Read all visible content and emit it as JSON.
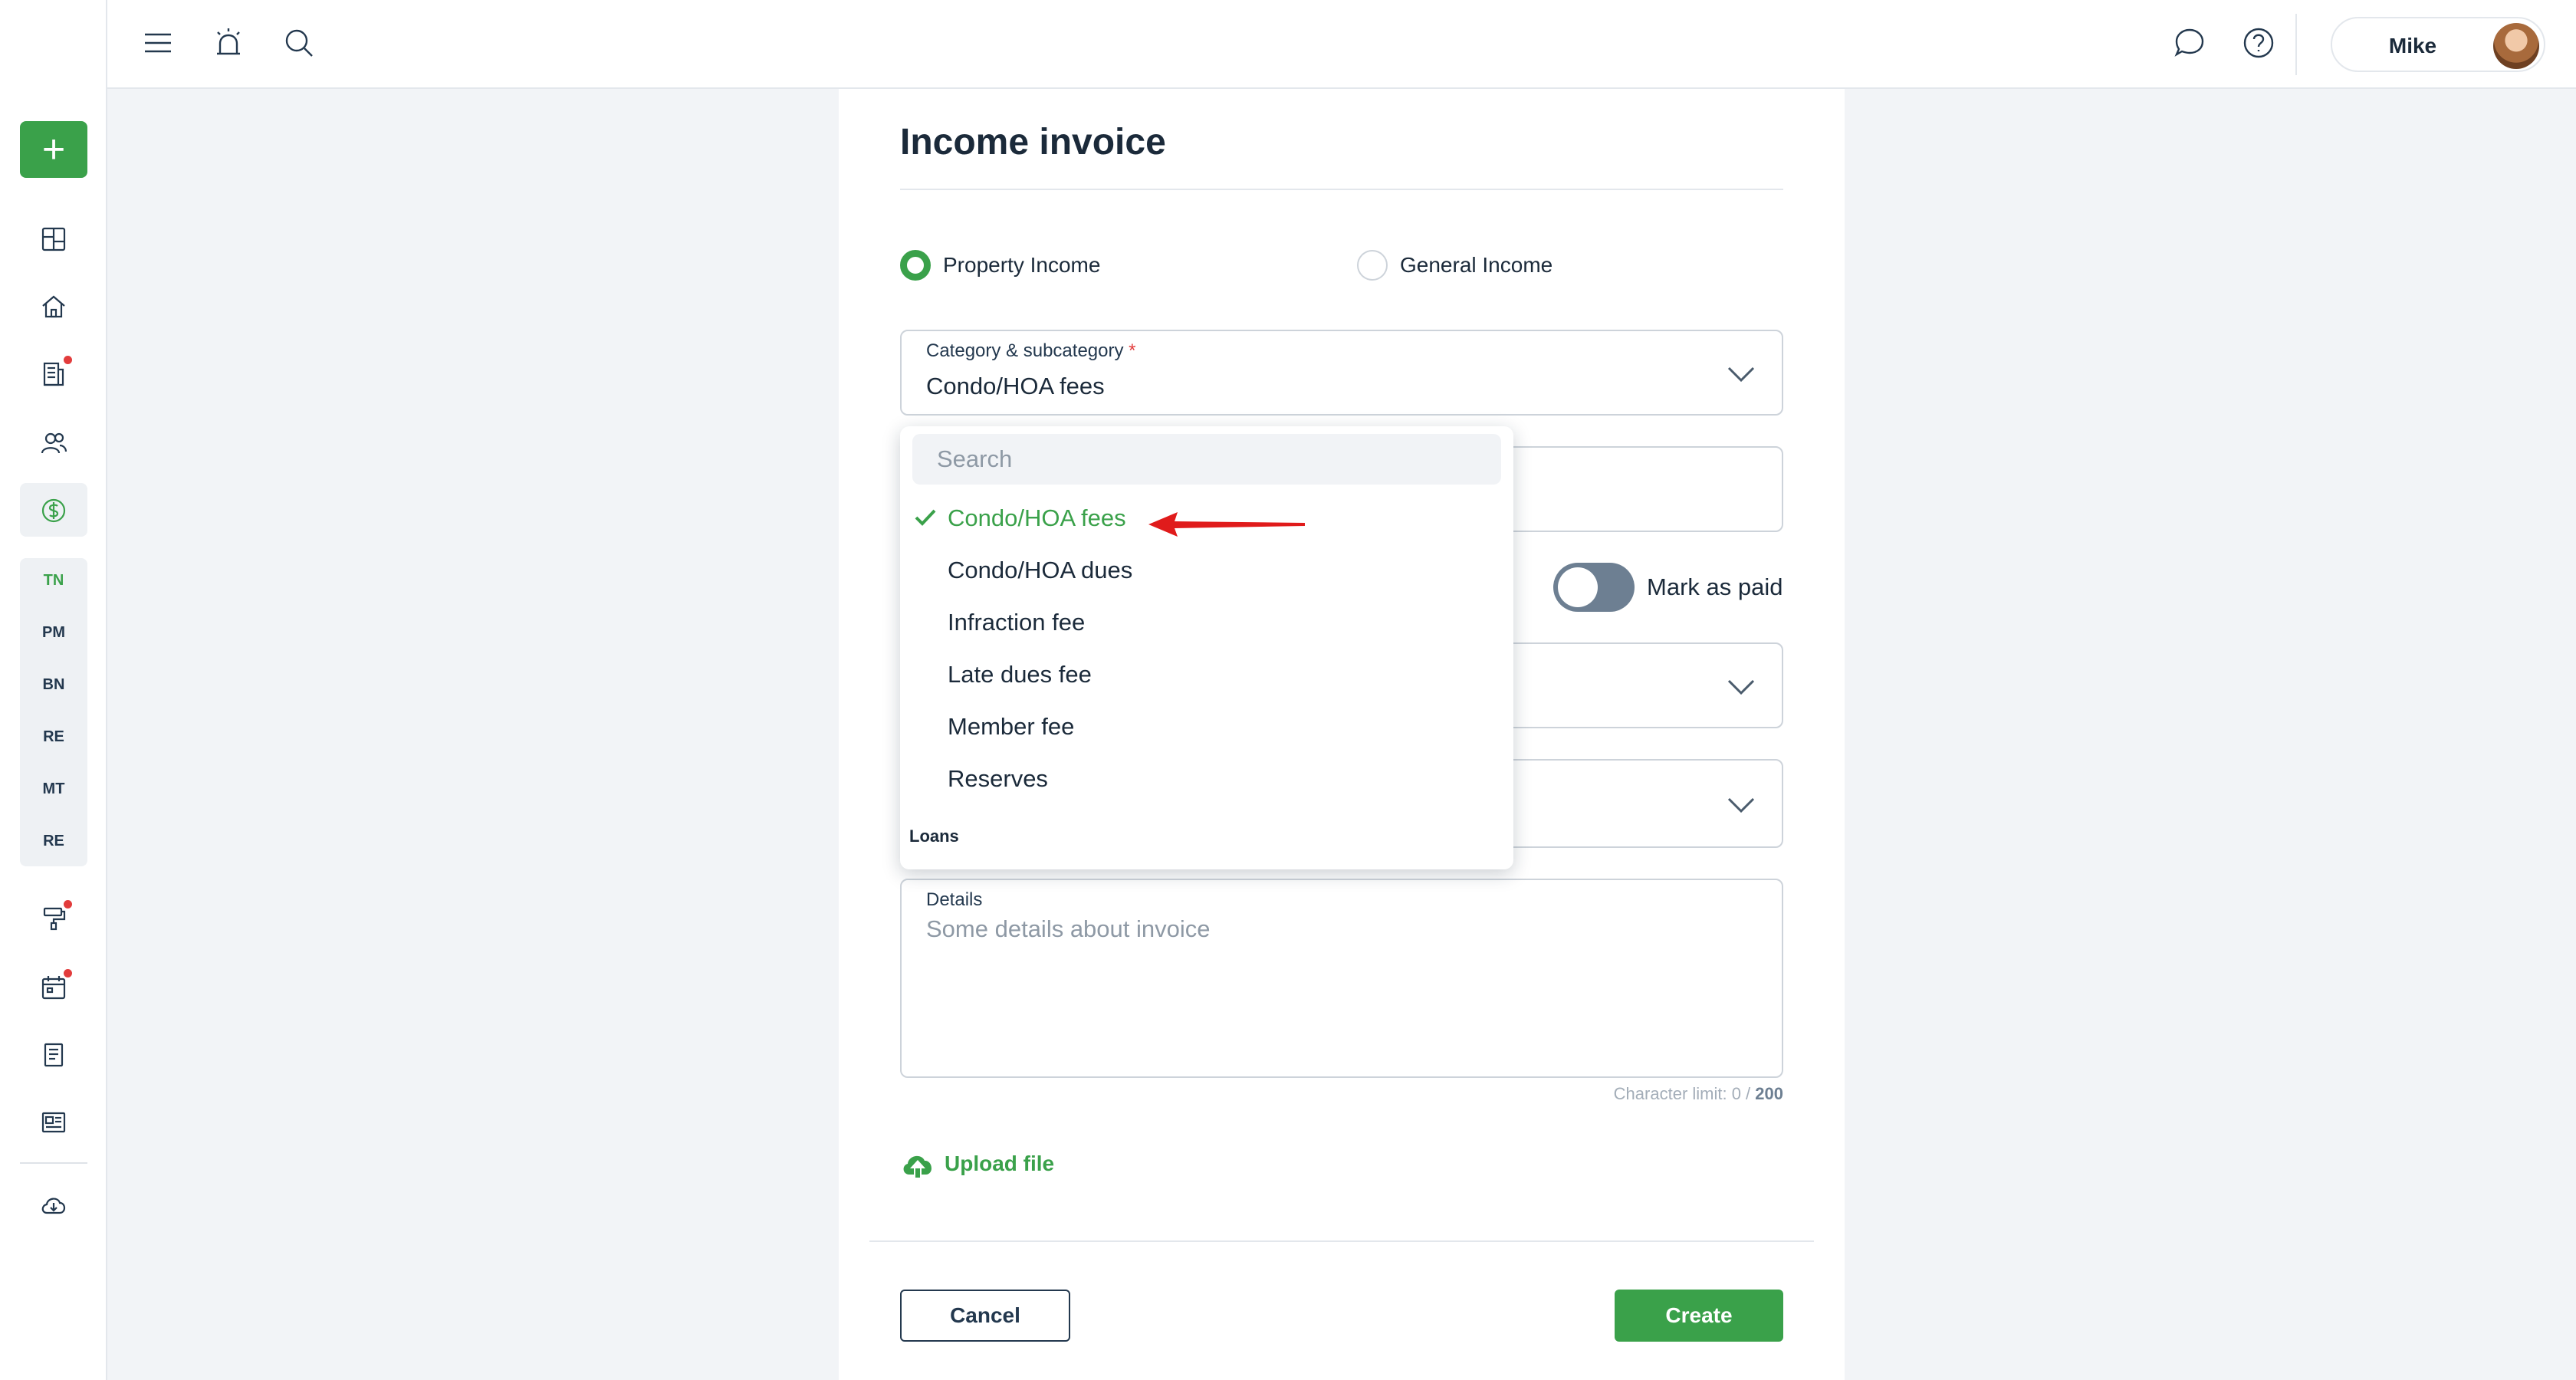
{
  "sidebar": {
    "add_label": "+",
    "abbreviations": [
      "TN",
      "PM",
      "BN",
      "RE",
      "MT",
      "RE"
    ]
  },
  "user": {
    "name": "Mike"
  },
  "form": {
    "title": "Income invoice",
    "radio_property": "Property Income",
    "radio_general": "General Income",
    "category_label": "Category & subcategory",
    "category_required": "*",
    "category_value": "Condo/HOA fees",
    "mark_paid_label": "Mark as paid",
    "details_label": "Details",
    "details_placeholder": "Some details about invoice",
    "char_limit_prefix": "Character limit: 0 / ",
    "char_limit_max": "200",
    "upload_label": "Upload file",
    "cancel_label": "Cancel",
    "create_label": "Create"
  },
  "dropdown": {
    "search_placeholder": "Search",
    "items": [
      {
        "label": "Condo/HOA fees",
        "selected": true
      },
      {
        "label": "Condo/HOA dues",
        "selected": false
      },
      {
        "label": "Infraction fee",
        "selected": false
      },
      {
        "label": "Late dues fee",
        "selected": false
      },
      {
        "label": "Member fee",
        "selected": false
      },
      {
        "label": "Reserves",
        "selected": false
      }
    ],
    "group_label": "Loans"
  },
  "colors": {
    "accent": "#3aa14a",
    "annotation_arrow": "#e01b1b",
    "notification_dot": "#e23c3c"
  }
}
